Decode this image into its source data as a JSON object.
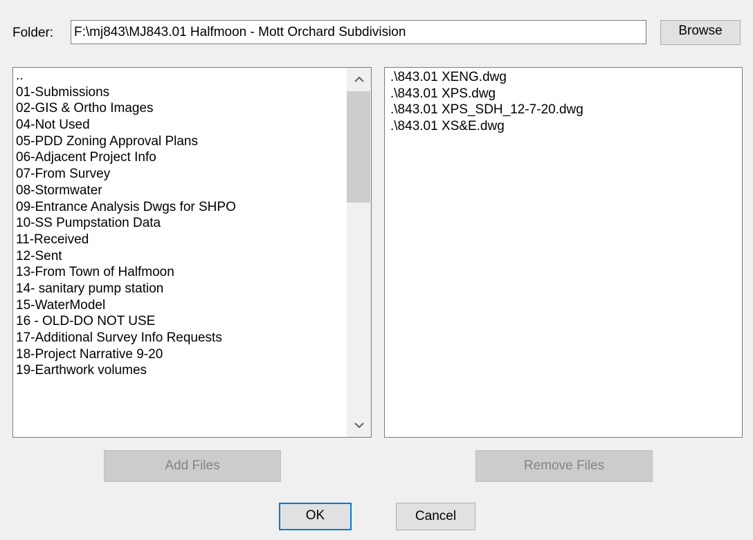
{
  "folder": {
    "label": "Folder:",
    "value": "F:\\mj843\\MJ843.01 Halfmoon - Mott Orchard Subdivision",
    "browse_label": "Browse"
  },
  "left_list": {
    "items": [
      "..",
      "01-Submissions",
      "02-GIS & Ortho Images",
      "04-Not Used",
      "05-PDD Zoning Approval Plans",
      "06-Adjacent Project Info",
      "07-From Survey",
      "08-Stormwater",
      "09-Entrance Analysis Dwgs for SHPO",
      "10-SS Pumpstation Data",
      "11-Received",
      "12-Sent",
      "13-From Town of Halfmoon",
      "14- sanitary pump station",
      "15-WaterModel",
      "16 - OLD-DO NOT USE",
      "17-Additional Survey Info Requests",
      "18-Project Narrative 9-20",
      "19-Earthwork volumes"
    ],
    "scroll_up_icon": "chevron-up-icon",
    "scroll_down_icon": "chevron-down-icon"
  },
  "right_list": {
    "items": [
      ".\\843.01 XENG.dwg",
      ".\\843.01 XPS.dwg",
      ".\\843.01 XPS_SDH_12-7-20.dwg",
      ".\\843.01 XS&E.dwg"
    ]
  },
  "actions": {
    "add_files_label": "Add Files",
    "remove_files_label": "Remove Files",
    "ok_label": "OK",
    "cancel_label": "Cancel"
  }
}
